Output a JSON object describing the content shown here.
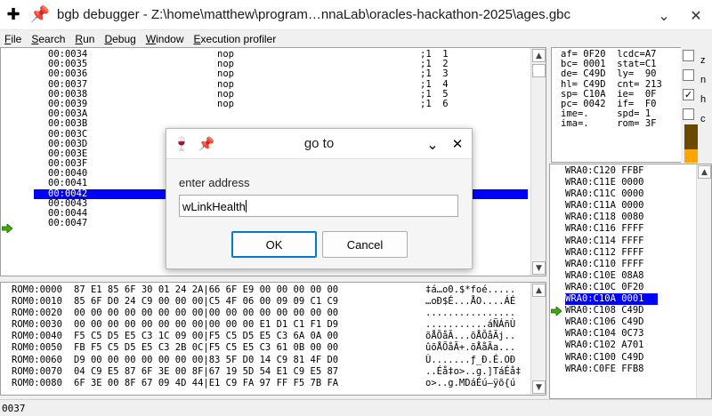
{
  "window": {
    "title": "bgb debugger - Z:\\home\\matthew\\program…nnaLab\\oracles-hackathon-2025\\ages.gbc",
    "app_icon": "plus-move-icon",
    "pin_icon": "pin-icon"
  },
  "menu": [
    "File",
    "Search",
    "Run",
    "Debug",
    "Window",
    "Execution profiler"
  ],
  "code_rows": [
    {
      "addr": "00:0034",
      "instr": "nop",
      "comment": ";1  1",
      "sel": false
    },
    {
      "addr": "00:0035",
      "instr": "nop",
      "comment": ";1  2",
      "sel": false
    },
    {
      "addr": "00:0036",
      "instr": "nop",
      "comment": ";1  3",
      "sel": false
    },
    {
      "addr": "00:0037",
      "instr": "nop",
      "comment": ";1  4",
      "sel": false
    },
    {
      "addr": "00:0038",
      "instr": "nop",
      "comment": ";1  5",
      "sel": false
    },
    {
      "addr": "00:0039",
      "instr": "nop",
      "comment": ";1  6",
      "sel": false
    },
    {
      "addr": "00:003A",
      "instr": "",
      "comment": "",
      "sel": false
    },
    {
      "addr": "00:003B",
      "instr": "",
      "comment": "",
      "sel": false
    },
    {
      "addr": "00:003C",
      "instr": "",
      "comment": "",
      "sel": false
    },
    {
      "addr": "00:003D",
      "instr": "",
      "comment": "",
      "sel": false
    },
    {
      "addr": "00:003E",
      "instr": "",
      "comment": "",
      "sel": false
    },
    {
      "addr": "00:003F",
      "instr": "",
      "comment": "",
      "sel": false
    },
    {
      "addr": "00:0040",
      "instr": "",
      "comment": "",
      "sel": false
    },
    {
      "addr": "00:0041",
      "instr": "",
      "comment": "",
      "sel": false
    },
    {
      "addr": "00:0042",
      "instr": "",
      "comment": "",
      "sel": true
    },
    {
      "addr": "00:0043",
      "instr": "",
      "comment": "",
      "sel": false
    },
    {
      "addr": "00:0044",
      "instr": "",
      "comment": "",
      "sel": false
    },
    {
      "addr": "00:0047",
      "instr": "",
      "comment": "",
      "sel": false
    }
  ],
  "registers": [
    "af= 0F20  lcdc=A7",
    "bc= 0001  stat=C1",
    "de= C49D  ly=  90",
    "hl= C49D  cnt= 213",
    "sp= C10A  ie=  0F",
    "pc= 0042  if=  F0",
    "ime=.     spd= 1",
    "ima=.     rom= 3F"
  ],
  "flags": [
    {
      "label": "z",
      "checked": false
    },
    {
      "label": "n",
      "checked": false
    },
    {
      "label": "h",
      "checked": true
    },
    {
      "label": "c",
      "checked": false
    }
  ],
  "meter_level": 0.35,
  "memory_rows": [
    {
      "addr": "ROM0:0000",
      "hex": "87 E1 85 6F 30 01 24 2A|66 6F E9 00 00 00 00 00",
      "ascii": "‡á…o0.$*foé....."
    },
    {
      "addr": "ROM0:0010",
      "hex": "85 6F D0 24 C9 00 00 00|C5 4F 06 00 09 09 C1 C9",
      "ascii": "…oÐ$É...ÅO....ÁÉ"
    },
    {
      "addr": "ROM0:0020",
      "hex": "00 00 00 00 00 00 00 00|00 00 00 00 00 00 00 00",
      "ascii": "................"
    },
    {
      "addr": "ROM0:0030",
      "hex": "00 00 00 00 00 00 00 00|00 00 00 E1 D1 C1 F1 D9",
      "ascii": "...........áÑÁñÙ"
    },
    {
      "addr": "ROM0:0040",
      "hex": "F5 C5 D5 E5 C3 1C 09 00|F5 C5 D5 E5 C3 6A 0A 00",
      "ascii": "õÅÕåÃ...õÅÕåÃj.."
    },
    {
      "addr": "ROM0:0050",
      "hex": "FB F5 C5 D5 E5 C3 2B 0C|F5 C5 E5 C3 61 0B 00 00",
      "ascii": "ûõÅÕåÃ+.õÅåÃa..."
    },
    {
      "addr": "ROM0:0060",
      "hex": "D9 00 00 00 00 00 00 00|83 5F D0 14 C9 81 4F D0",
      "ascii": "Ù.......ƒ_Ð.É.OÐ"
    },
    {
      "addr": "ROM0:0070",
      "hex": "04 C9 E5 87 6F 3E 00 8F|67 19 5D 54 E1 C9 E5 87",
      "ascii": "..Éå‡o>..g.]TáÉå‡"
    },
    {
      "addr": "ROM0:0080",
      "hex": "6F 3E 00 8F 67 09 4D 44|E1 C9 FA 97 FF F5 7B FA",
      "ascii": "o>..g.MDáÉú—ÿõ{ú"
    }
  ],
  "stack_rows": [
    {
      "text": "WRA0:C120 FFBF",
      "sel": false
    },
    {
      "text": "WRA0:C11E 0000",
      "sel": false
    },
    {
      "text": "WRA0:C11C 0000",
      "sel": false
    },
    {
      "text": "WRA0:C11A 0000",
      "sel": false
    },
    {
      "text": "WRA0:C118 0080",
      "sel": false
    },
    {
      "text": "WRA0:C116 FFFF",
      "sel": false
    },
    {
      "text": "WRA0:C114 FFFF",
      "sel": false
    },
    {
      "text": "WRA0:C112 FFFF",
      "sel": false
    },
    {
      "text": "WRA0:C110 FFFF",
      "sel": false
    },
    {
      "text": "WRA0:C10E 08A8",
      "sel": false
    },
    {
      "text": "WRA0:C10C 0F20",
      "sel": false
    },
    {
      "text": "WRA0:C10A 0001",
      "sel": true
    },
    {
      "text": "WRA0:C108 C49D",
      "sel": false
    },
    {
      "text": "WRA0:C106 C49D",
      "sel": false
    },
    {
      "text": "WRA0:C104 0C73",
      "sel": false
    },
    {
      "text": "WRA0:C102 A701",
      "sel": false
    },
    {
      "text": "WRA0:C100 C49D",
      "sel": false
    },
    {
      "text": "WRA0:C0FE FFB8",
      "sel": false
    }
  ],
  "status": "0037",
  "dialog": {
    "title": "go to",
    "label": "enter address",
    "input_value": "wLinkHealth",
    "ok_label": "OK",
    "cancel_label": "Cancel"
  },
  "colors": {
    "selection": "#0000ff",
    "meter_dark": "#6b4a00",
    "meter_fill": "#ffa500",
    "highlight_cell": "#c8c8c8"
  }
}
